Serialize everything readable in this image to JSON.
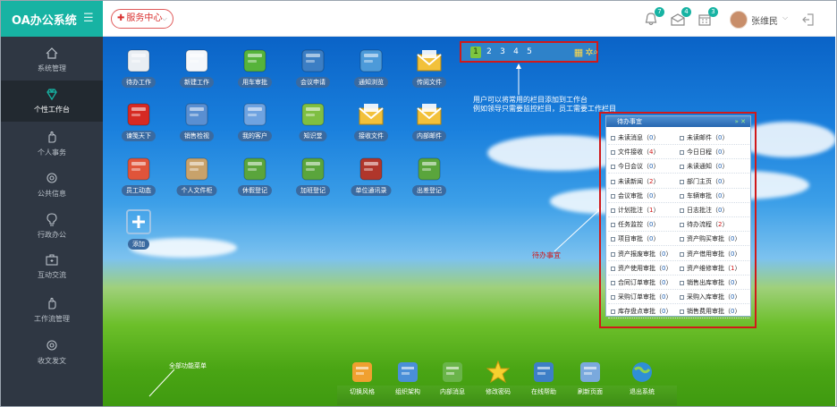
{
  "app": {
    "title": "OA办公系统"
  },
  "topbar": {
    "service_label": "服务中心",
    "badges": {
      "bell": "7",
      "mail": "4",
      "calendar": "3"
    },
    "user_name": "张维民"
  },
  "sidebar": {
    "items": [
      {
        "label": "系统管理",
        "icon": "home-icon",
        "active": false
      },
      {
        "label": "个性工作台",
        "icon": "diamond-icon",
        "active": true
      },
      {
        "label": "个人事务",
        "icon": "hand-icon",
        "active": false
      },
      {
        "label": "公共信息",
        "icon": "gear-icon",
        "active": false
      },
      {
        "label": "行政办公",
        "icon": "bulb-icon",
        "active": false
      },
      {
        "label": "互动交流",
        "icon": "briefcase-icon",
        "active": false
      },
      {
        "label": "工作流管理",
        "icon": "hand-icon",
        "active": false
      },
      {
        "label": "收文发文",
        "icon": "gear-icon",
        "active": false
      }
    ]
  },
  "desktop_icons": [
    {
      "label": "待办工作",
      "icon": "clipboard-icon",
      "color": "#e9eef3"
    },
    {
      "label": "新建工作",
      "icon": "person-icon",
      "color": "#f4f7fb"
    },
    {
      "label": "用车审批",
      "icon": "truck-icon",
      "color": "#56b33a"
    },
    {
      "label": "会议申请",
      "icon": "meeting-icon",
      "color": "#3c7ec4"
    },
    {
      "label": "通知浏览",
      "icon": "megaphone-icon",
      "color": "#4c9ad9"
    },
    {
      "label": "传阅文件",
      "icon": "envelope-icon",
      "color": "#f2c13b"
    },
    {
      "label": "谏笺天下",
      "icon": "tablet-icon",
      "color": "#d62a23"
    },
    {
      "label": "销售检视",
      "icon": "building-icon",
      "color": "#5a8fd1"
    },
    {
      "label": "我的客户",
      "icon": "users-icon",
      "color": "#6fa3e0"
    },
    {
      "label": "知识堂",
      "icon": "group-icon",
      "color": "#7fbf42"
    },
    {
      "label": "接收文件",
      "icon": "envelope-icon",
      "color": "#f2c13b"
    },
    {
      "label": "内部邮件",
      "icon": "envelope-icon",
      "color": "#f2c13b"
    },
    {
      "label": "员工动态",
      "icon": "boxes-icon",
      "color": "#e0543a"
    },
    {
      "label": "个人文件柜",
      "icon": "folder-icon",
      "color": "#c8a26b"
    },
    {
      "label": "休假登记",
      "icon": "form-icon",
      "color": "#5aa53c"
    },
    {
      "label": "加班登记",
      "icon": "form-icon",
      "color": "#5aa53c"
    },
    {
      "label": "单位通讯录",
      "icon": "book-icon",
      "color": "#b0362b"
    },
    {
      "label": "出差登记",
      "icon": "form-icon",
      "color": "#5aa53c"
    },
    {
      "label": "添加",
      "icon": "plus-icon",
      "color": "#9ec4e6"
    }
  ],
  "pager": {
    "pages": [
      "1",
      "2",
      "3",
      "4",
      "5"
    ]
  },
  "annotation": {
    "line1": "用户可以将常用的栏目添加到工作台",
    "line2": "例如领导只需要监控栏目，员工需要工作栏目",
    "todo_label": "待办事宜",
    "dock_hint": "全部功能菜单"
  },
  "todo": {
    "title": "待办事宜",
    "rows": [
      [
        {
          "label": "未读消息",
          "count": "0"
        },
        {
          "label": "未读邮件",
          "count": "0"
        }
      ],
      [
        {
          "label": "文件接收",
          "count": "4"
        },
        {
          "label": "今日日程",
          "count": "0"
        }
      ],
      [
        {
          "label": "今日会议",
          "count": "0"
        },
        {
          "label": "未读通知",
          "count": "0"
        }
      ],
      [
        {
          "label": "未读新闻",
          "count": "2"
        },
        {
          "label": "部门主页",
          "count": "0"
        }
      ],
      [
        {
          "label": "会议审批",
          "count": "0"
        },
        {
          "label": "车辆审批",
          "count": "0"
        }
      ],
      [
        {
          "label": "计划批注",
          "count": "1"
        },
        {
          "label": "日志批注",
          "count": "0"
        }
      ],
      [
        {
          "label": "任务监控",
          "count": "0"
        },
        {
          "label": "待办流程",
          "count": "2"
        }
      ],
      [
        {
          "label": "项目审批",
          "count": "0"
        },
        {
          "label": "资产购买审批",
          "count": "0"
        }
      ],
      [
        {
          "label": "资产报废审批",
          "count": "0"
        },
        {
          "label": "资产借用审批",
          "count": "0"
        }
      ],
      [
        {
          "label": "资产使用审批",
          "count": "0"
        },
        {
          "label": "资产维修审批",
          "count": "1"
        }
      ],
      [
        {
          "label": "合同订单审批",
          "count": "0"
        },
        {
          "label": "销售出库审批",
          "count": "0"
        }
      ],
      [
        {
          "label": "采购订单审批",
          "count": "0"
        },
        {
          "label": "采购入库审批",
          "count": "0"
        }
      ],
      [
        {
          "label": "库存盘点审批",
          "count": "0"
        },
        {
          "label": "销售费用审批",
          "count": "0"
        }
      ]
    ]
  },
  "dock": [
    {
      "label": "切换风格",
      "icon": "palette-icon",
      "color": "#f0a030"
    },
    {
      "label": "组织架构",
      "icon": "org-icon",
      "color": "#4a8fd8"
    },
    {
      "label": "内部消息",
      "icon": "chat-icon",
      "color": "#6ab44a"
    },
    {
      "label": "修改密码",
      "icon": "star-icon",
      "color": "#f6d12f"
    },
    {
      "label": "在线帮助",
      "icon": "at-book-icon",
      "color": "#3d7fc7"
    },
    {
      "label": "刷新页面",
      "icon": "refresh-icon",
      "color": "#7aa9dd"
    },
    {
      "label": "退出系统",
      "icon": "globe-icon",
      "color": "#2f8fd6"
    }
  ]
}
